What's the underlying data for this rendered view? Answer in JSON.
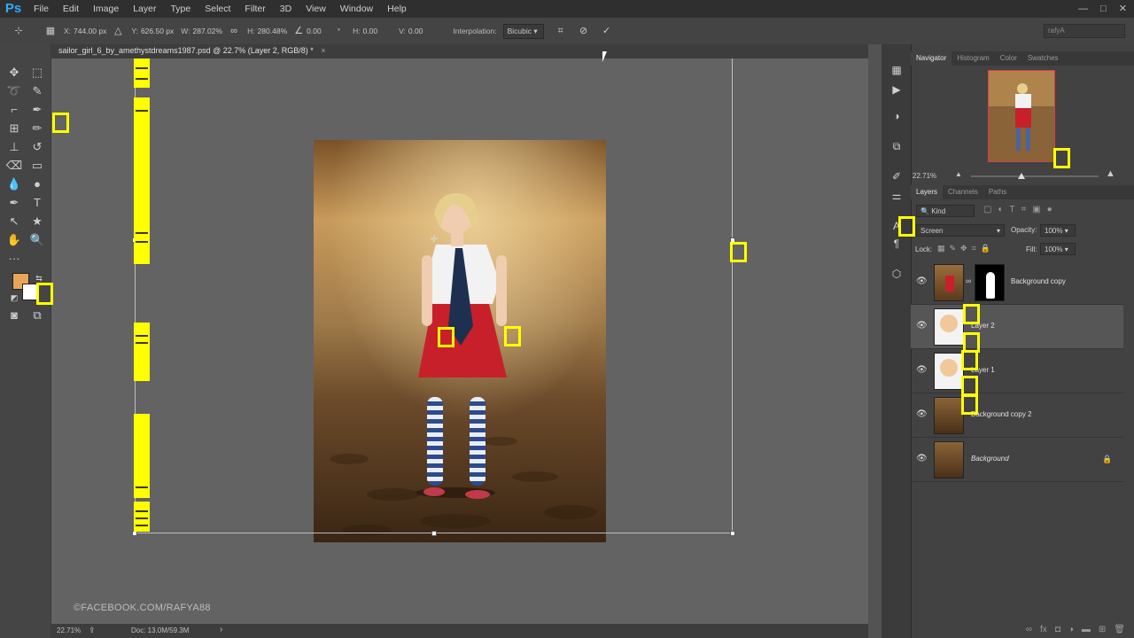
{
  "app": {
    "logo": "Ps",
    "menu": [
      "File",
      "Edit",
      "Image",
      "Layer",
      "Type",
      "Select",
      "Filter",
      "3D",
      "View",
      "Window",
      "Help"
    ],
    "window_controls": [
      "—",
      "□",
      "✕"
    ]
  },
  "options": {
    "x_label": "X:",
    "x_value": "744.00 px",
    "y_label": "Y:",
    "y_value": "626.50 px",
    "w_label": "W:",
    "w_value": "287.02%",
    "h_label": "H:",
    "h_value": "280.48%",
    "angle_value": "0.00",
    "angle_unit": "°",
    "hskew_label": "H:",
    "hskew_value": "0.00",
    "vskew_label": "V:",
    "vskew_value": "0.00",
    "interp_label": "Interpolation:",
    "interp_value": "Bicubic",
    "workspace_search": "rafyA"
  },
  "document": {
    "tab_title": "sailor_girl_6_by_amethystdreams1987.psd @ 22.7% (Layer 2, RGB/8) *",
    "tab_close": "×",
    "watermark": "©FACEBOOK.COM/RAFYA88",
    "status_zoom": "22.71%",
    "status_doc": "Doc: 13.0M/59.3M"
  },
  "navigator": {
    "tabs": [
      "Navigator",
      "Histogram",
      "Color",
      "Swatches"
    ],
    "zoom": "22.71%"
  },
  "layers_panel": {
    "tabs": [
      "Layers",
      "Channels",
      "Paths"
    ],
    "filter_kind": "Kind",
    "blend_mode": "Screen",
    "opacity_label": "Opacity:",
    "opacity_value": "100%",
    "lock_label": "Lock:",
    "fill_label": "Fill:",
    "fill_value": "100%",
    "layers": [
      {
        "name": "Background copy"
      },
      {
        "name": "Layer 2"
      },
      {
        "name": "Layer 1"
      },
      {
        "name": "Background copy 2"
      },
      {
        "name": "Background"
      }
    ]
  },
  "colors": {
    "foreground": "#e8a55a",
    "background": "#ffffff",
    "accent": "#31a8ff",
    "annotation": "#ffff00"
  }
}
